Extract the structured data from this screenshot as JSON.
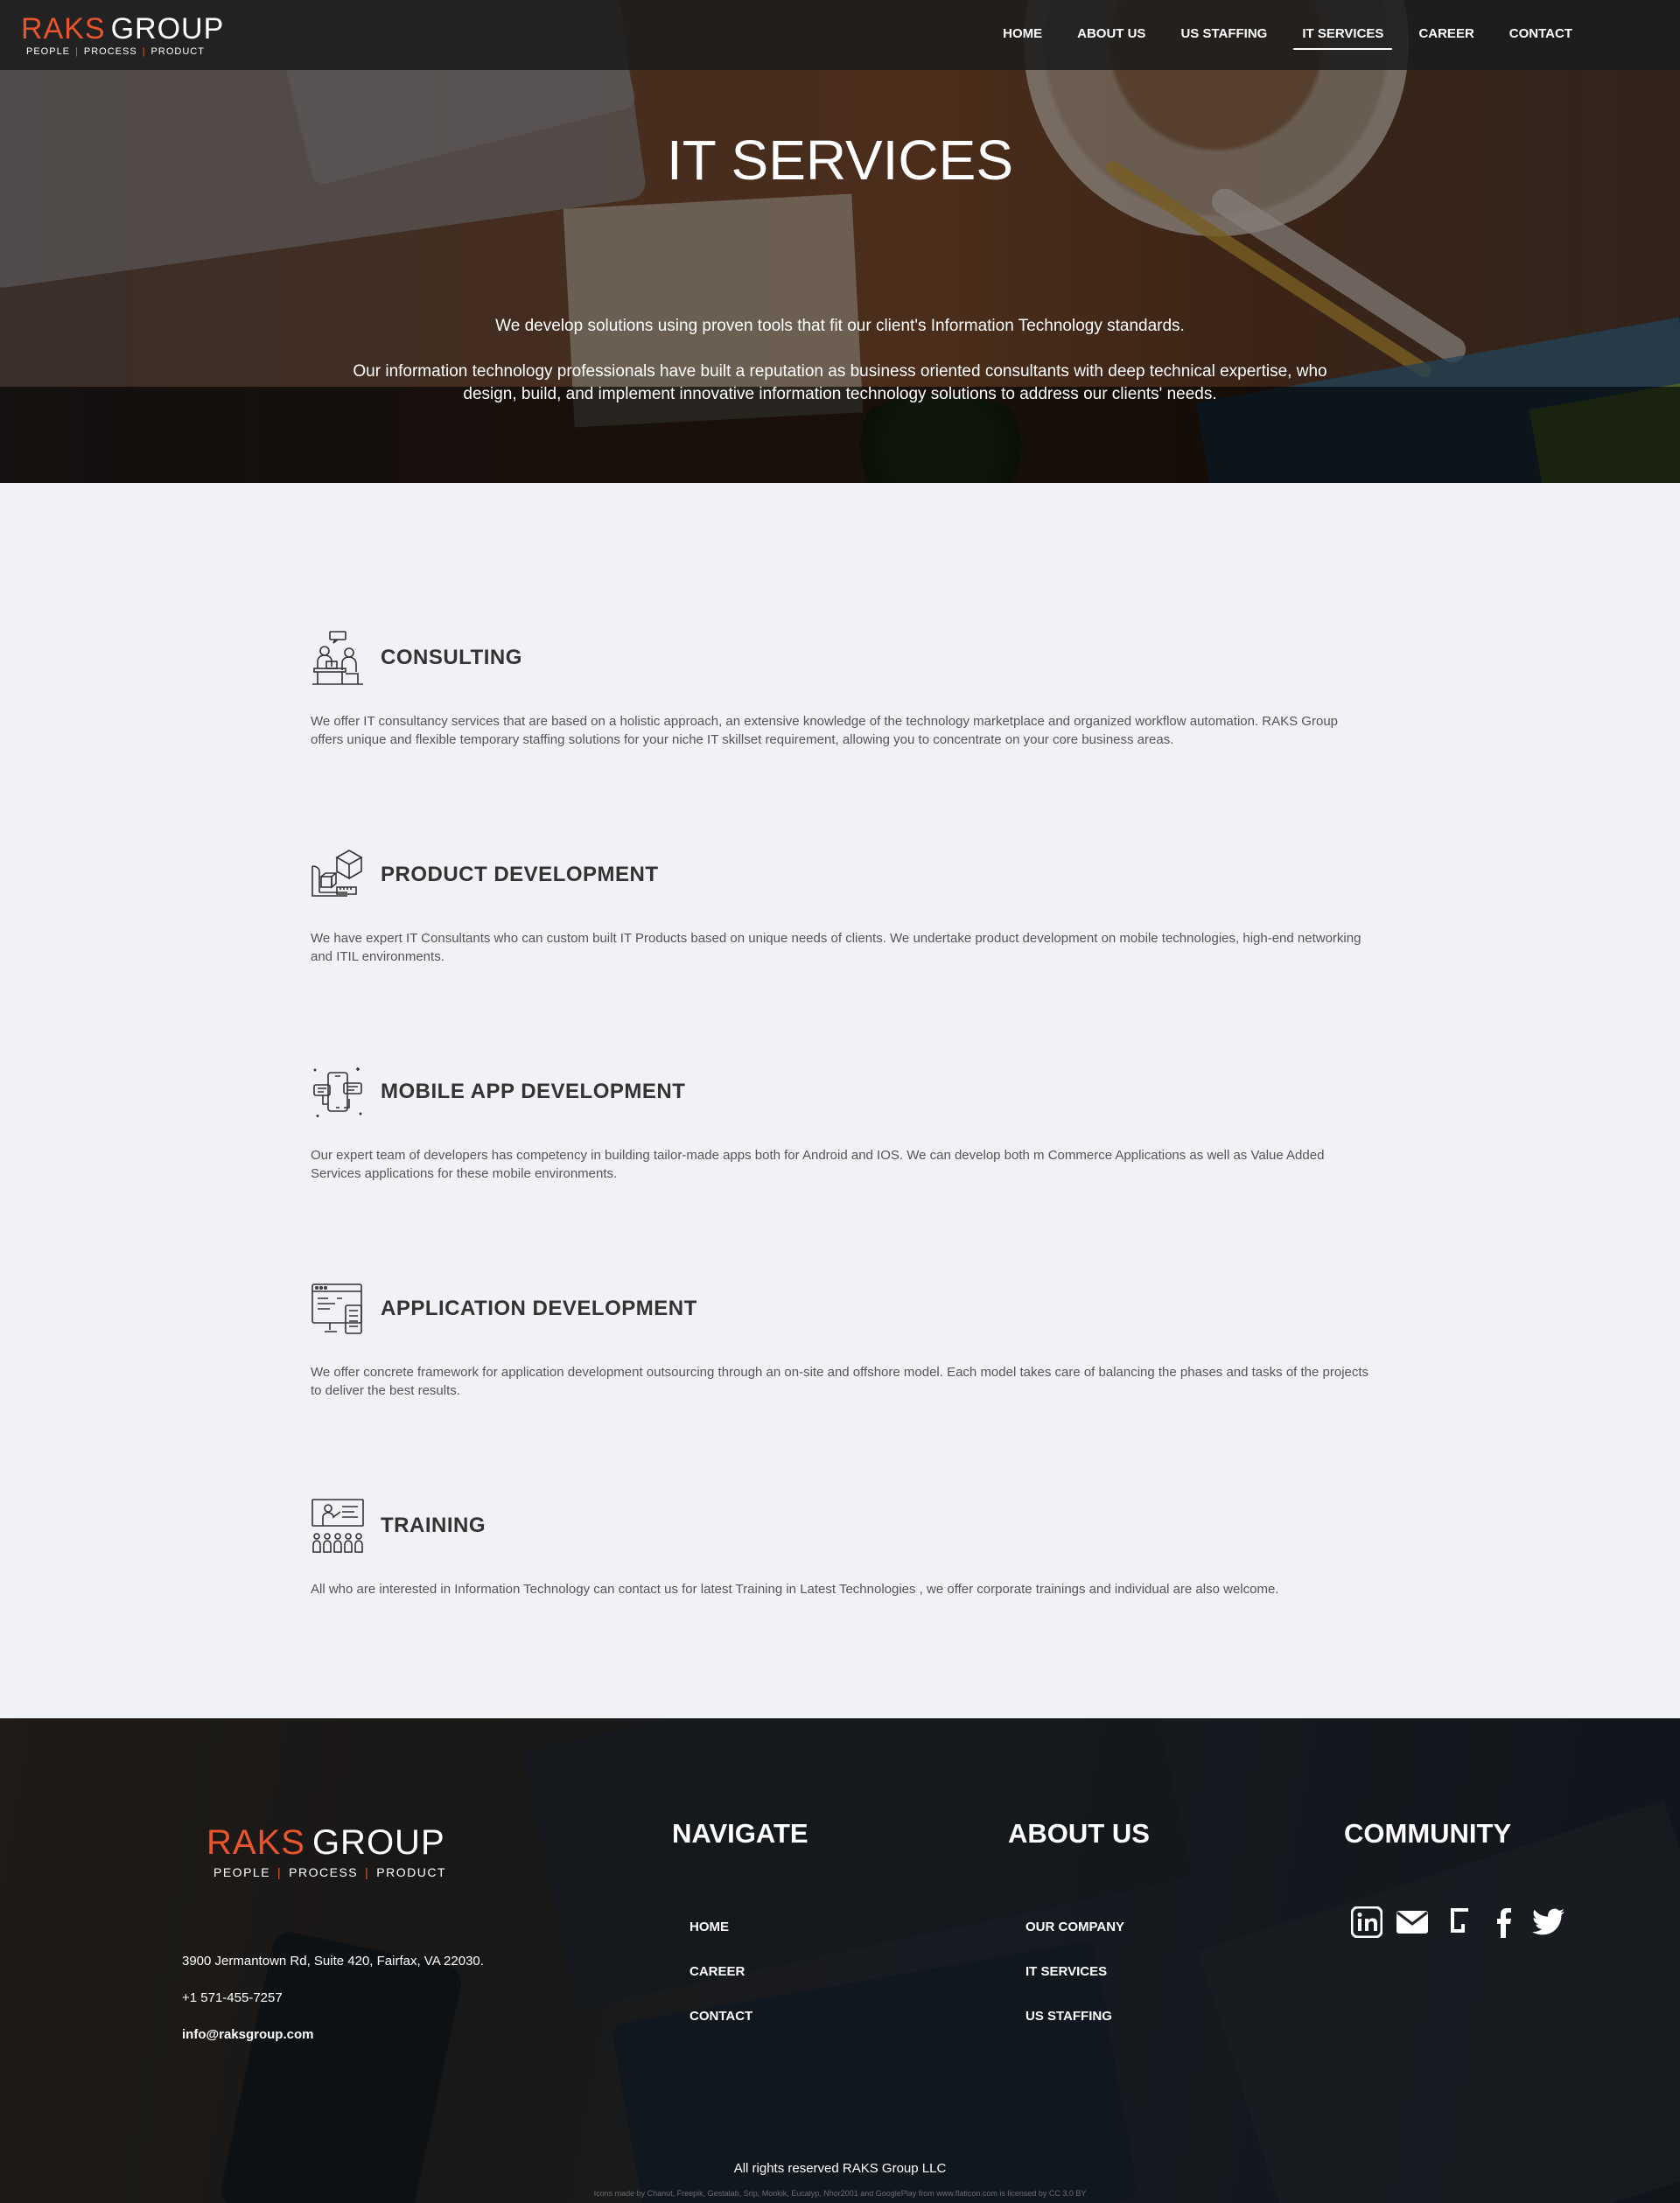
{
  "brand": {
    "word1": "RAKS",
    "word2": "GROUP",
    "tag1": "PEOPLE",
    "tag2": "PROCESS",
    "tag3": "PRODUCT",
    "separator": "|",
    "accent_color": "#e8552d"
  },
  "nav": {
    "items": [
      {
        "label": "HOME"
      },
      {
        "label": "ABOUT US"
      },
      {
        "label": "US STAFFING"
      },
      {
        "label": "IT SERVICES"
      },
      {
        "label": "CAREER"
      },
      {
        "label": "CONTACT"
      }
    ],
    "active": "IT SERVICES"
  },
  "hero": {
    "title": "IT SERVICES",
    "paragraph1": "We develop solutions using proven tools that fit our client's Information Technology standards.",
    "paragraph2": "Our information technology professionals have built a reputation as business oriented consultants with deep technical expertise, who design, build, and implement innovative information technology solutions to address our clients' needs."
  },
  "services": [
    {
      "icon": "consulting-icon",
      "title": "CONSULTING",
      "text": "We offer IT consultancy services that are based on a holistic approach, an extensive knowledge of the technology marketplace and organized workflow automation. RAKS Group offers unique and flexible temporary staffing solutions for your niche IT skillset requirement, allowing you to concentrate on your core business areas."
    },
    {
      "icon": "product-development-icon",
      "title": "PRODUCT DEVELOPMENT",
      "text": "We have expert IT Consultants who can custom built IT Products based on unique needs of clients. We undertake product development on mobile technologies, high-end networking and ITIL environments."
    },
    {
      "icon": "mobile-app-icon",
      "title": "MOBILE APP DEVELOPMENT",
      "text": "Our expert team of developers has competency in building tailor-made apps both for Android and IOS. We can develop both m Commerce Applications as well as Value Added Services applications for these mobile environments."
    },
    {
      "icon": "application-development-icon",
      "title": "APPLICATION DEVELOPMENT",
      "text": "We offer concrete framework for application development outsourcing through an on-site and offshore model. Each model takes care of balancing the phases and tasks of the projects to deliver the best results."
    },
    {
      "icon": "training-icon",
      "title": "TRAINING",
      "text": "All who are interested in Information Technology can contact us for latest Training in Latest Technologies , we offer corporate trainings and individual are also welcome."
    }
  ],
  "footer": {
    "address": "3900 Jermantown Rd, Suite 420, Fairfax, VA 22030.",
    "phone": "+1 571-455-7257",
    "email": "info@raksgroup.com",
    "navigate": {
      "title": "NAVIGATE",
      "links": [
        "HOME",
        "CAREER",
        "CONTACT"
      ]
    },
    "about": {
      "title": "ABOUT US",
      "links": [
        "OUR COMPANY",
        "IT SERVICES",
        "US STAFFING"
      ]
    },
    "community": {
      "title": "COMMUNITY",
      "icons": [
        "linkedin-icon",
        "email-icon",
        "glassdoor-icon",
        "facebook-icon",
        "twitter-icon"
      ]
    },
    "copyright": "All rights reserved RAKS Group LLC",
    "credit": "Icons made by Chanut, Freepik, Gestalab, Srip, Monkik, Eucalyp, Nhor2001 and GooglePlay from www.flaticon.com is licensed by CC 3.0 BY"
  }
}
